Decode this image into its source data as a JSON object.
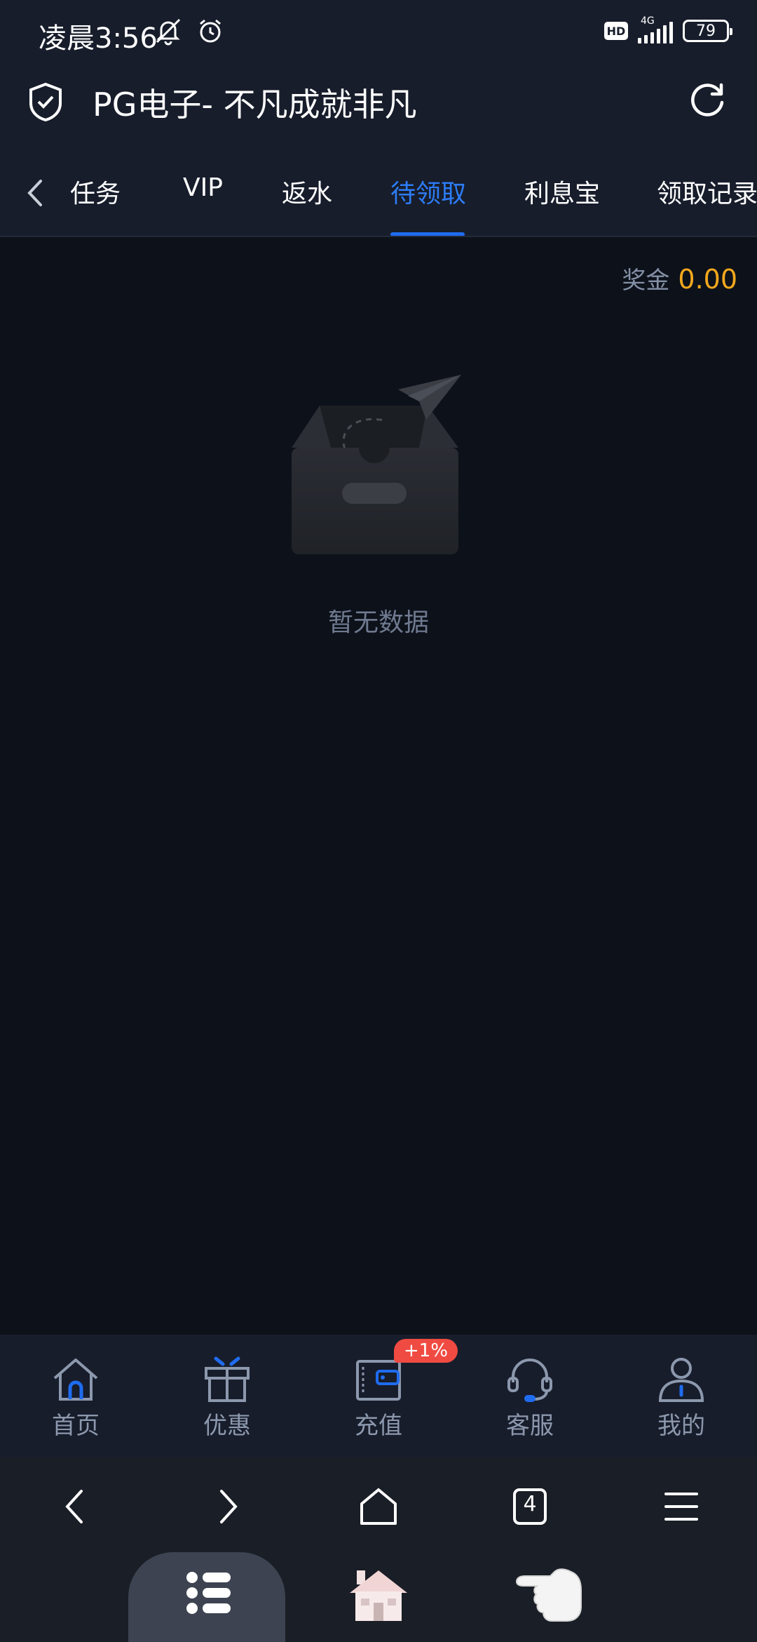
{
  "status_bar": {
    "time": "凌晨3:56",
    "hd": "HD",
    "network": "4G",
    "battery": "79"
  },
  "header": {
    "title": "PG电子- 不凡成就非凡"
  },
  "tabs": [
    {
      "label": "任务"
    },
    {
      "label": "VIP"
    },
    {
      "label": "返水"
    },
    {
      "label": "待领取"
    },
    {
      "label": "利息宝"
    },
    {
      "label": "领取记录"
    }
  ],
  "active_tab": "待领取",
  "bonus": {
    "label": "奖金",
    "value": "0.00"
  },
  "empty_state": {
    "text": "暂无数据"
  },
  "bottom_nav": [
    {
      "label": "首页",
      "icon": "home-icon"
    },
    {
      "label": "优惠",
      "icon": "gift-icon"
    },
    {
      "label": "充值",
      "icon": "wallet-icon"
    },
    {
      "label": "客服",
      "icon": "headset-icon"
    },
    {
      "label": "我的",
      "icon": "user-icon"
    }
  ],
  "promo_badge": "+1%",
  "browser_bar": {
    "tab_count": "4"
  },
  "colors": {
    "accent": "#1f6cf0",
    "bonus": "#f3a81d",
    "badge": "#f04b42",
    "background": "#0d111a",
    "bar": "#171d2b"
  }
}
